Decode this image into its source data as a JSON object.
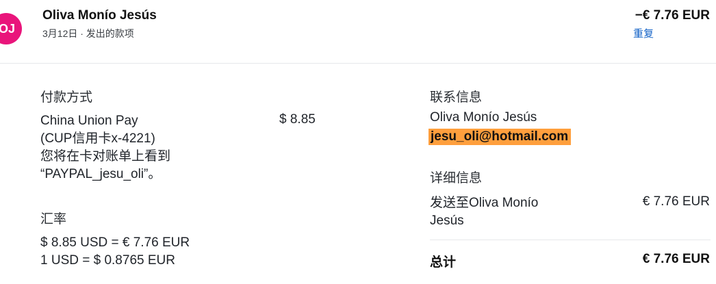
{
  "header": {
    "avatar_initials": "OJ",
    "name": "Oliva Monío Jesús",
    "meta": "3月12日 · 发出的款项",
    "amount": "−€ 7.76 EUR",
    "repeat_label": "重复"
  },
  "payment_method": {
    "title": "付款方式",
    "lines": [
      "China Union Pay",
      "(CUP信用卡x-4221)",
      "您将在卡对账单上看到",
      "“PAYPAL_jesu_oli”。"
    ],
    "amount": "$ 8.85"
  },
  "exchange_rate": {
    "title": "汇率",
    "lines": [
      "$ 8.85 USD = € 7.76 EUR",
      "1 USD = $ 0.8765 EUR"
    ]
  },
  "contact": {
    "title": "联系信息",
    "name": "Oliva Monío Jesús",
    "email": "jesu_oli@hotmail.com"
  },
  "details": {
    "title": "详细信息",
    "lines": [
      "发送至Oliva Monío",
      "Jesús"
    ],
    "amount": "€ 7.76 EUR"
  },
  "total": {
    "label": "总计",
    "amount": "€ 7.76 EUR"
  },
  "colors": {
    "avatar_bg": "#e9157b",
    "link": "#1463c7",
    "highlight": "#ff9f3d"
  }
}
